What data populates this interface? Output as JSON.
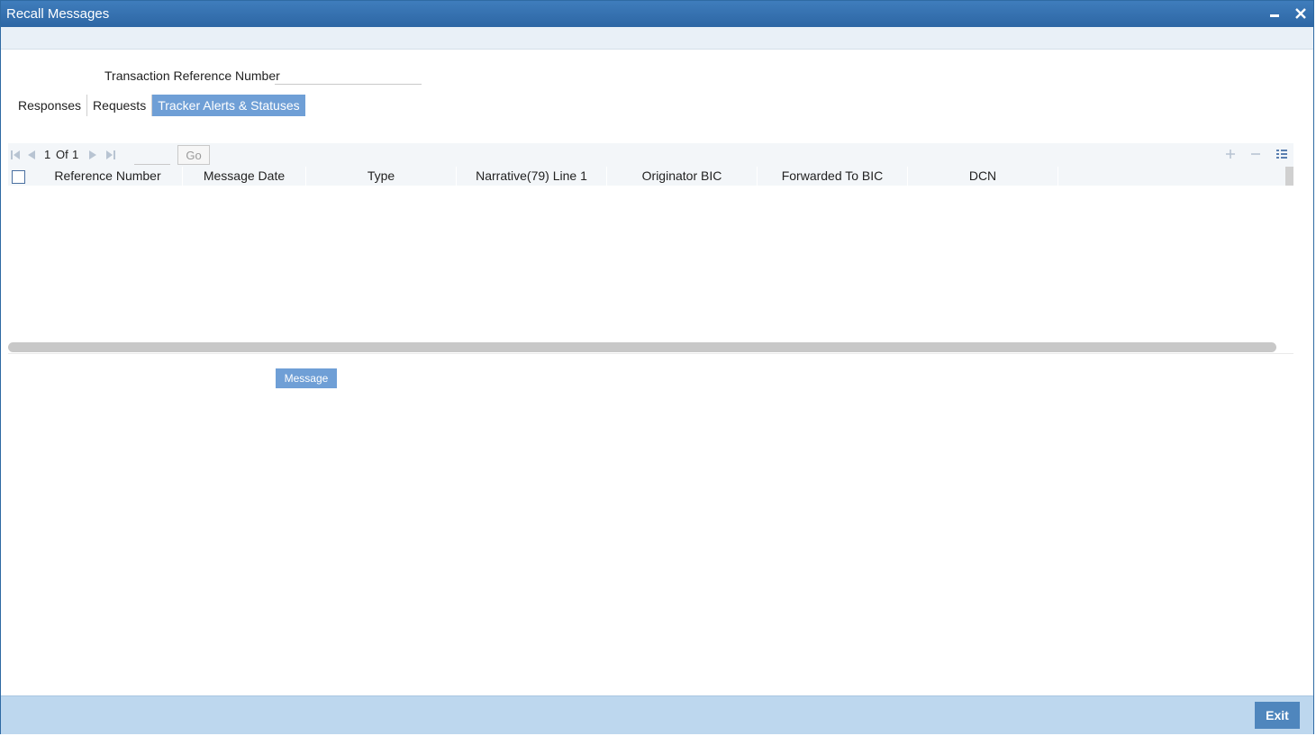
{
  "window": {
    "title": "Recall Messages"
  },
  "form": {
    "transaction_reference_label": "Transaction Reference Number",
    "transaction_reference_value": ""
  },
  "tabs": [
    {
      "label": "Responses",
      "active": false
    },
    {
      "label": "Requests",
      "active": false
    },
    {
      "label": "Tracker Alerts & Statuses",
      "active": true
    }
  ],
  "pager": {
    "current_page": "1",
    "of_label": "Of",
    "total_pages": "1",
    "go_label": "Go"
  },
  "grid": {
    "columns": [
      "Reference Number",
      "Message Date",
      "Type",
      "Narrative(79) Line 1",
      "Originator BIC",
      "Forwarded To BIC",
      "DCN"
    ],
    "rows": []
  },
  "buttons": {
    "message_label": "Message",
    "exit_label": "Exit"
  },
  "icons": {
    "minimize": "minimize-icon",
    "close": "close-icon",
    "first": "first-page-icon",
    "prev": "previous-page-icon",
    "next": "next-page-icon",
    "last": "last-page-icon",
    "add": "add-row-icon",
    "delete": "delete-row-icon",
    "view": "single-view-icon"
  },
  "colors": {
    "titlebar": "#2d66a4",
    "accent": "#6f9fd6",
    "footer": "#bdd7ee",
    "exit": "#4f86bd"
  }
}
